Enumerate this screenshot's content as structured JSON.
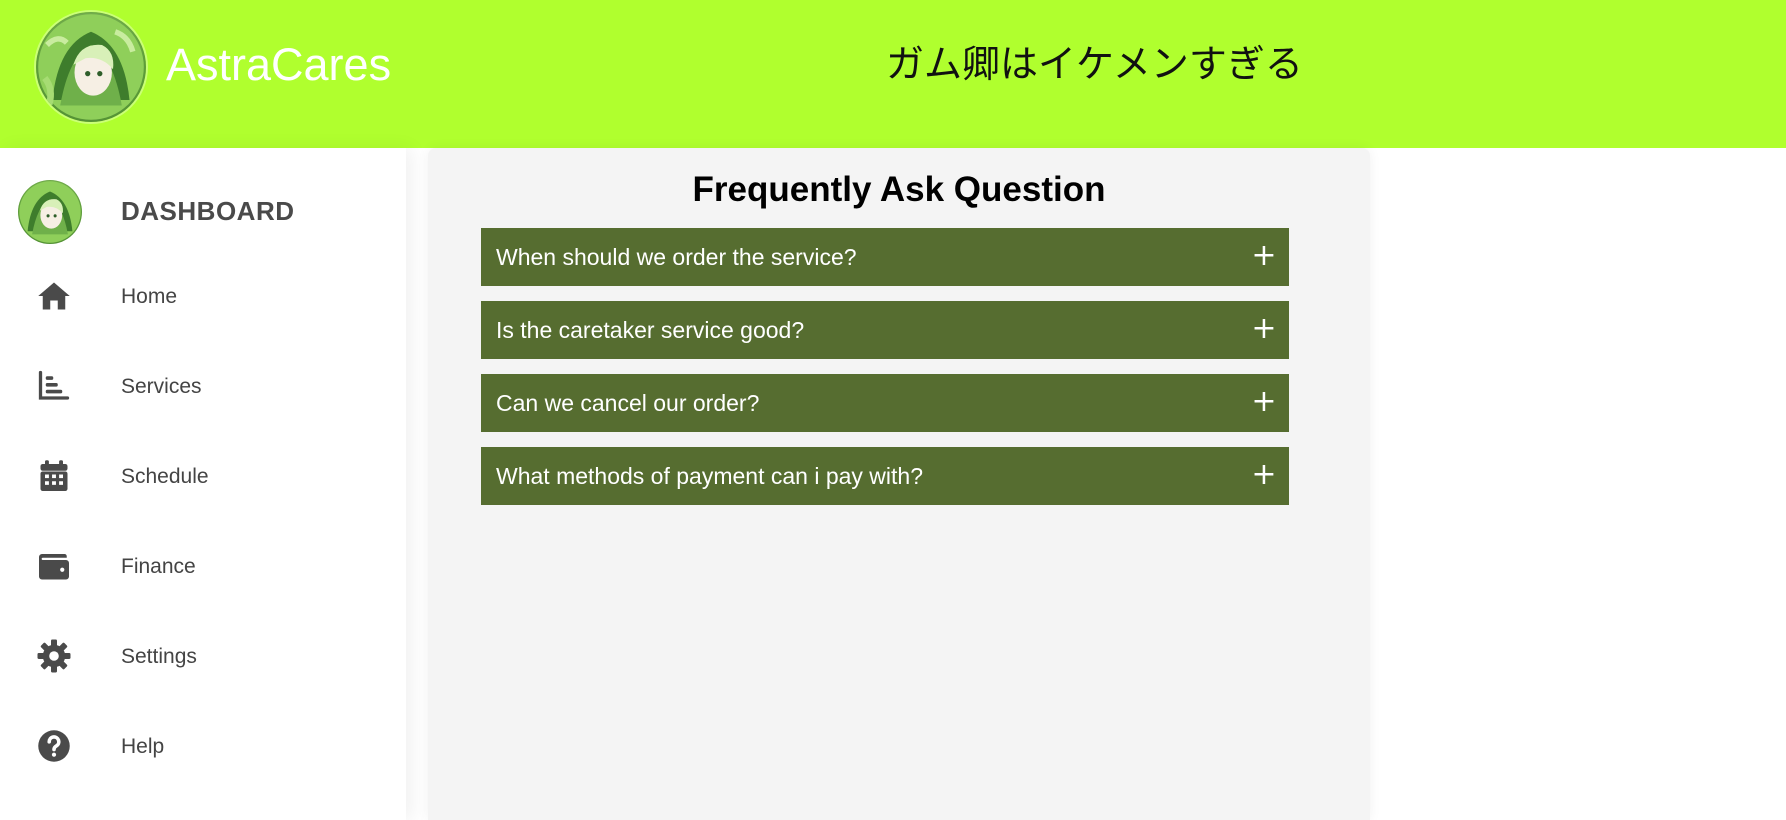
{
  "header": {
    "brand": "AstraCares",
    "tagline": "ガム卿はイケメンすぎる",
    "logo_icon": "anime-girl-avatar-icon"
  },
  "sidebar": {
    "title": "DASHBOARD",
    "avatar_icon": "anime-girl-avatar-icon",
    "items": [
      {
        "label": "Home",
        "icon": "home-icon"
      },
      {
        "label": "Services",
        "icon": "bar-chart-icon"
      },
      {
        "label": "Schedule",
        "icon": "calendar-icon"
      },
      {
        "label": "Finance",
        "icon": "wallet-icon"
      },
      {
        "label": "Settings",
        "icon": "gear-icon"
      },
      {
        "label": "Help",
        "icon": "question-circle-icon"
      }
    ]
  },
  "faq": {
    "title": "Frequently Ask Question",
    "toggle_symbol": "+",
    "items": [
      {
        "question": "When should we order the service?"
      },
      {
        "question": "Is the caretaker service good?"
      },
      {
        "question": "Can we cancel our order?"
      },
      {
        "question": "What methods of payment can i pay with?"
      }
    ]
  },
  "colors": {
    "header_bg": "#b0ff2e",
    "faq_item_bg": "#566d30",
    "main_bg": "#f4f4f4",
    "icon_color": "#4a4a4a"
  }
}
